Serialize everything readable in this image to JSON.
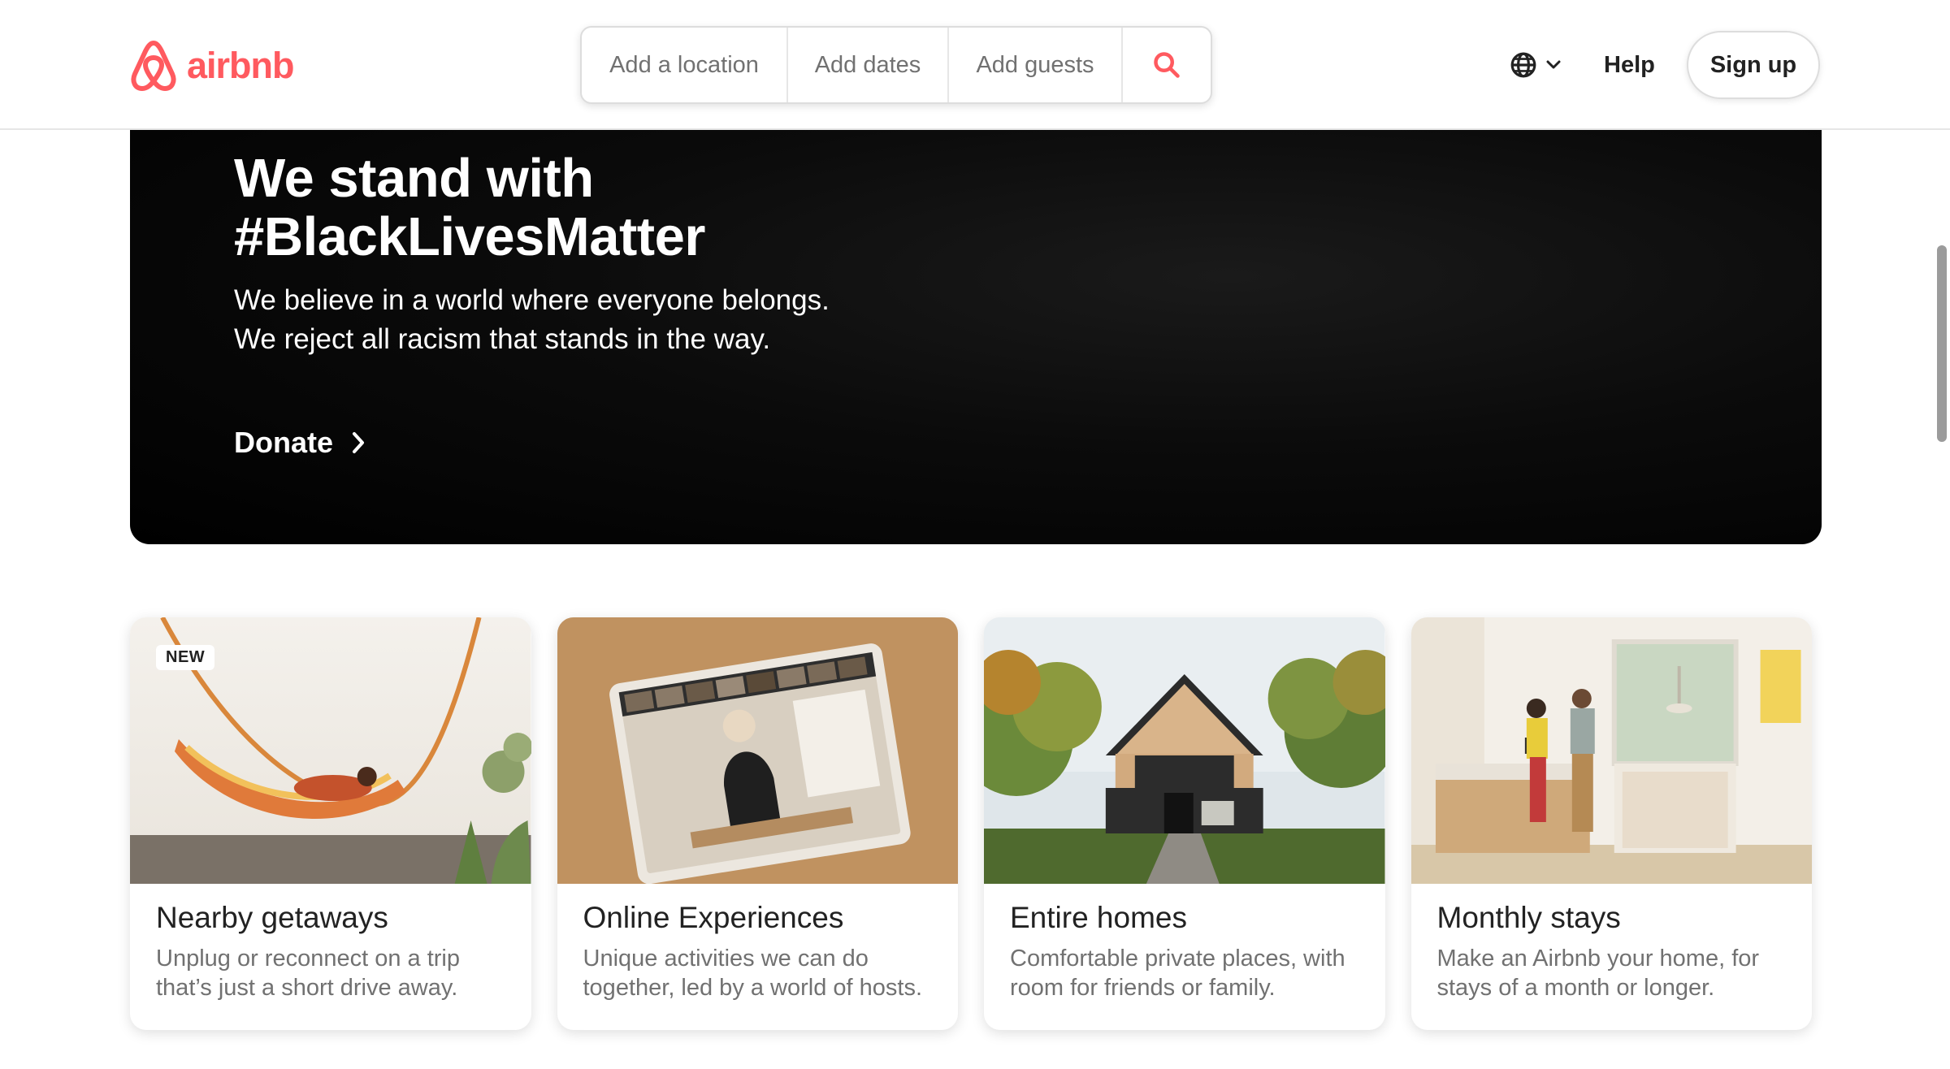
{
  "brand": {
    "name": "airbnb",
    "color": "#FF5A5F"
  },
  "header": {
    "search": {
      "location": "Add a location",
      "dates": "Add dates",
      "guests": "Add guests",
      "button_icon": "search-icon"
    },
    "language_icon": "globe-icon",
    "help": "Help",
    "sign_up": "Sign up"
  },
  "hero": {
    "title": "We stand with #BlackLivesMatter",
    "subtitle": "We believe in a world where everyone belongs. We reject all racism that stands in the way.",
    "cta": "Donate"
  },
  "cards": [
    {
      "badge": "NEW",
      "title": "Nearby getaways",
      "description": "Unplug or reconnect on a trip that’s just a short drive away."
    },
    {
      "title": "Online Experiences",
      "description": "Unique activities we can do together, led by a world of hosts."
    },
    {
      "title": "Entire homes",
      "description": "Comfortable private places, with room for friends or family."
    },
    {
      "title": "Monthly stays",
      "description": "Make an Airbnb your home, for stays of a month or longer."
    }
  ]
}
